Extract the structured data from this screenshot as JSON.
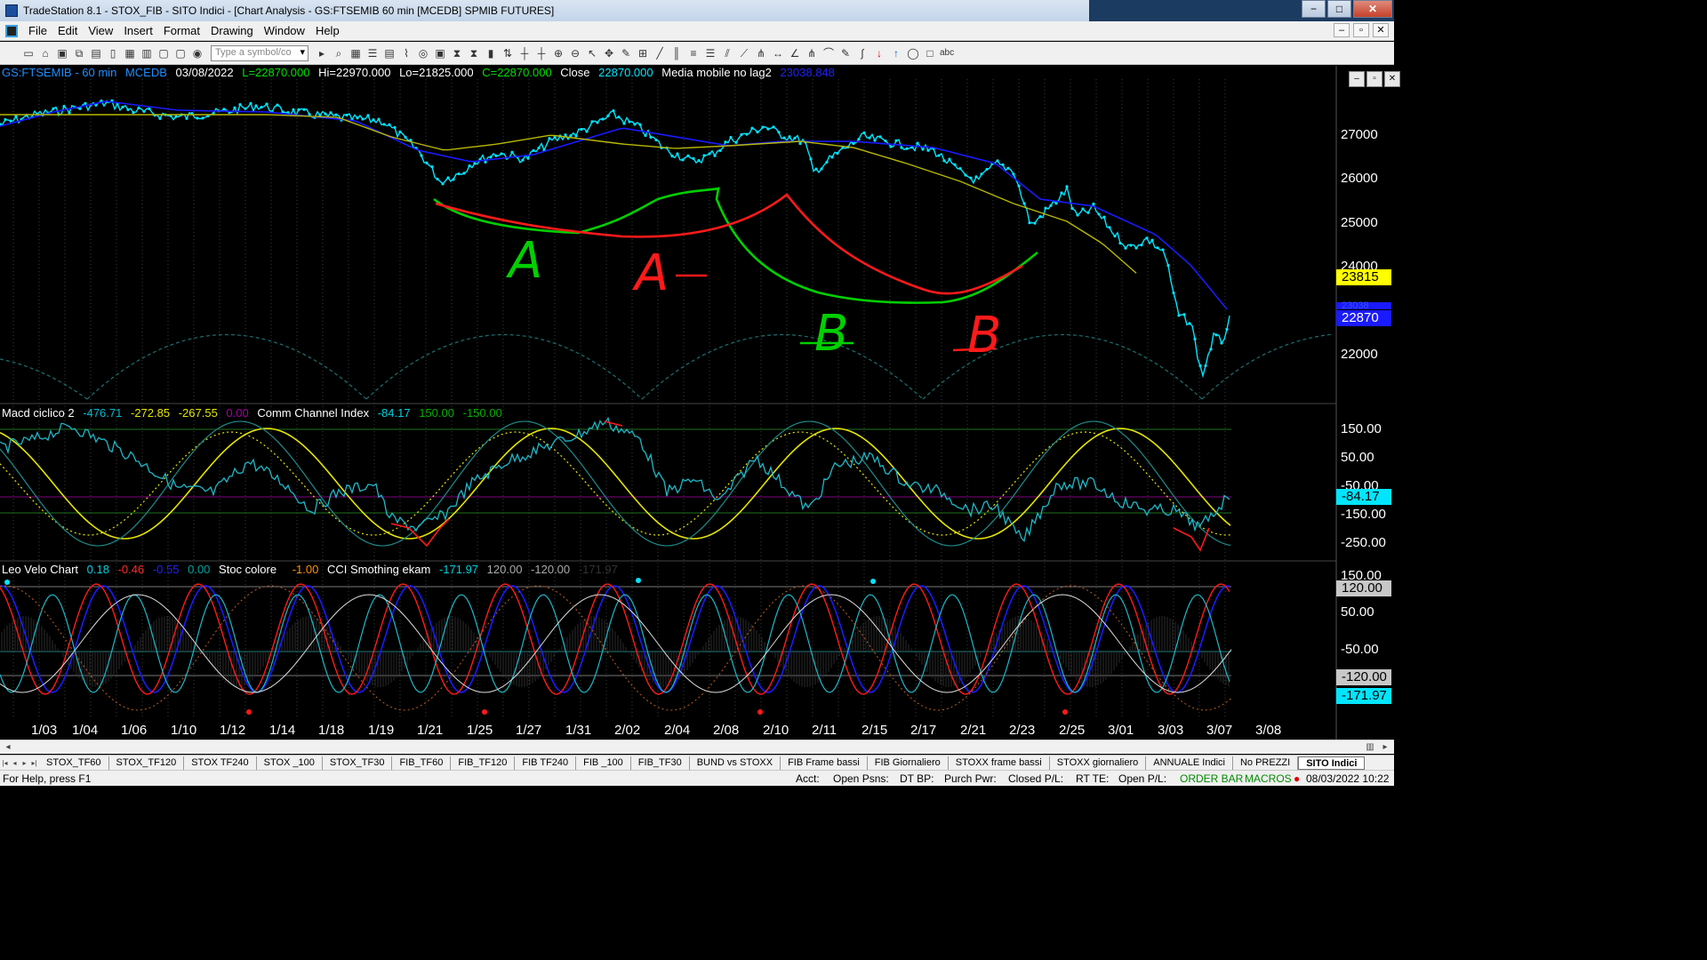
{
  "window": {
    "title": "TradeStation 8.1 - STOX_FIB - SITO Indici - [Chart Analysis - GS:FTSEMIB  60 min  [MCEDB] SPMIB FUTURES]",
    "minimize": "−",
    "maximize": "□",
    "close": "✕"
  },
  "menu": [
    "File",
    "Edit",
    "View",
    "Insert",
    "Format",
    "Drawing",
    "Window",
    "Help"
  ],
  "mdi_buttons": [
    "–",
    "▫",
    "✕"
  ],
  "toolbar": {
    "symbol_placeholder": "Type a symbol/co",
    "icons": [
      "new-icon",
      "open-icon",
      "save-icon",
      "copy-icon",
      "paste-icon",
      "lock-icon",
      "print-icon",
      "preview-icon",
      "window-icon",
      "window2-icon",
      "window3-icon",
      "globe-icon"
    ],
    "icons2": [
      "grid-icon",
      "list-icon",
      "table-icon",
      "chart-icon",
      "radar-icon",
      "news-icon",
      "bars-icon",
      "bars2-icon",
      "bars3-icon",
      "candle-icon",
      "zoom-in-icon",
      "zoom-out-icon",
      "cursor-icon",
      "hand-icon",
      "move-icon",
      "trend-icon",
      "hline-icon",
      "vline-icon",
      "channel-icon",
      "fib-icon",
      "arc-icon",
      "arrow-down-icon",
      "arrow-up-icon",
      "ellipse-icon",
      "rect-icon",
      "text-icon"
    ]
  },
  "price_pane": {
    "symbol": "GS:FTSEMIB - 60 min",
    "data": "MCEDB",
    "date": "03/08/2022",
    "last": "L=22870.000",
    "high": "Hi=22970.000",
    "low": "Lo=21825.000",
    "close_val": "C=22870.000",
    "close_label": "Close",
    "close_num": "22870.000",
    "ma_label": "Media mobile no lag2",
    "ma_val": "23038.848",
    "axis": [
      "27000",
      "26000",
      "25000",
      "24000",
      "22000"
    ],
    "tag_yellow": "23815",
    "tag_blue": "22870",
    "tag_blue_hidden": "23038"
  },
  "macd_pane": {
    "name": "Macd ciclico 2",
    "v1": "-476.71",
    "v2": "-272.85",
    "v3": "-267.55",
    "v4": "0.00",
    "cci_name": "Comm Channel Index",
    "cci_val": "-84.17",
    "cci_hi": "150.00",
    "cci_lo": "-150.00",
    "axis": [
      "150.00",
      "50.00",
      "-50.00",
      "-150.00",
      "-250.00"
    ],
    "tag": "-84.17"
  },
  "velo_pane": {
    "name": "Leo Velo Chart",
    "v1": "0.18",
    "v2": "-0.46",
    "v3": "-0.55",
    "v4": "0.00",
    "stoc_name": "Stoc colore",
    "stoc_val": "-1.00",
    "cci_name": "CCI Smothing ekam",
    "cci_val": "-171.97",
    "cci_hi": "120.00",
    "cci_lo": "-120.00",
    "cci_faint": "-171.97",
    "axis": [
      "150.00",
      "50.00",
      "-50.00"
    ],
    "tag_top": "120.00",
    "tag_mid": "-120.00",
    "tag_bottom": "-171.97"
  },
  "annotations": {
    "a1": "A",
    "a2": "A",
    "b1": "B",
    "b2": "B"
  },
  "dates": [
    "1/03",
    "1/04",
    "1/06",
    "1/10",
    "1/12",
    "1/14",
    "1/18",
    "1/19",
    "1/21",
    "1/25",
    "1/27",
    "1/31",
    "2/02",
    "2/04",
    "2/08",
    "2/10",
    "2/11",
    "2/15",
    "2/17",
    "2/21",
    "2/23",
    "2/25",
    "3/01",
    "3/03",
    "3/07",
    "3/08"
  ],
  "tabs": [
    "STOX_TF60",
    "STOX_TF120",
    "STOX TF240",
    "STOX _100",
    "STOX_TF30",
    "FIB_TF60",
    "FIB_TF120",
    "FIB TF240",
    "FIB _100",
    "FIB_TF30",
    "BUND vs STOXX",
    "FIB Frame bassi",
    "FIB Giornaliero",
    "STOXX frame bassi",
    "STOXX giornaliero",
    "ANNUALE Indici",
    "No PREZZI",
    "SITO Indici"
  ],
  "status": {
    "help": "For Help, press F1",
    "acct": "Acct:",
    "open_psns": "Open Psns:",
    "dt_bp": "DT BP:",
    "purch_pwr": "Purch Pwr:",
    "closed_pl": "Closed P/L:",
    "rt_te": "RT TE:",
    "open_pl": "Open P/L:",
    "order_bar": "ORDER BAR",
    "macros": "MACROS",
    "datetime": "08/03/2022 10:22"
  },
  "colors": {
    "cyan": "#00e5ff",
    "blue": "#1a1aff",
    "yellow": "#e5e500",
    "green": "#00d000",
    "red": "#ff1a1a",
    "tag_yellow_bg": "#ffff00",
    "tag_blue_bg": "#1a1aff"
  }
}
